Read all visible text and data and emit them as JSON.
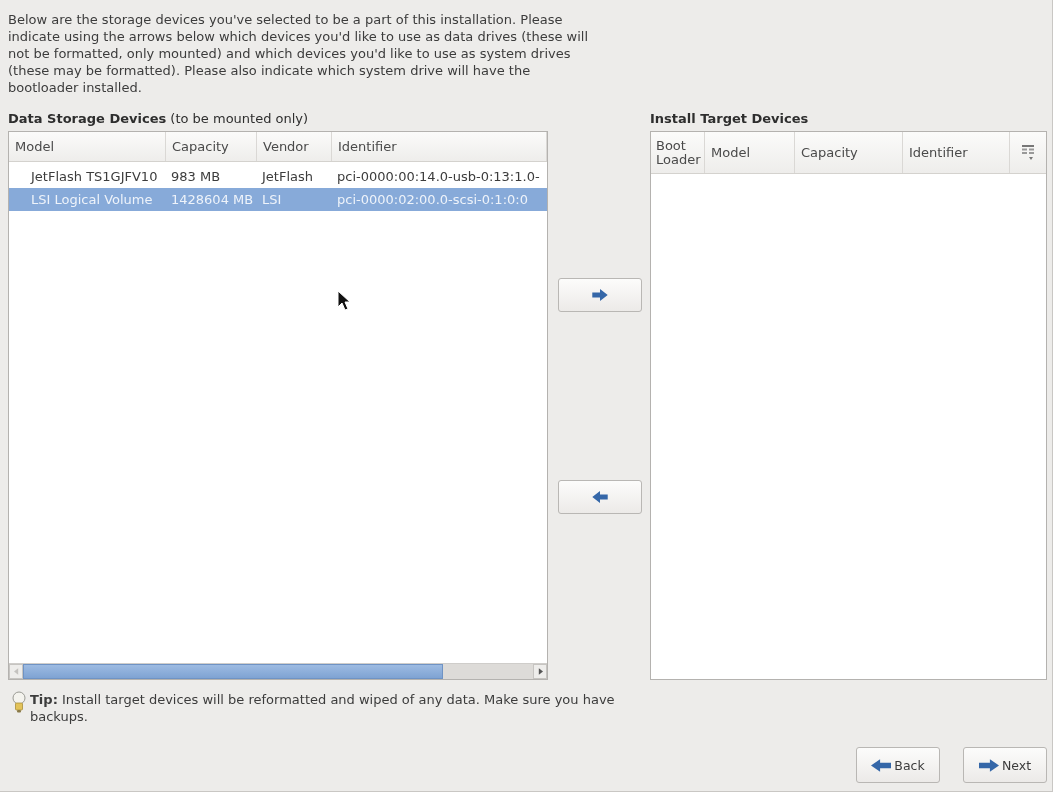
{
  "intro": {
    "text": "Below are the storage devices you've selected to be a part of this installation. Please indicate using the arrows below which devices you'd like to use as data drives (these will not be formatted, only mounted) and which devices you'd like to use as system drives (these may be formatted). Please also indicate which system drive will have the bootloader installed."
  },
  "data_storage": {
    "title": "**Data Storage Devices** (to be mounted only)",
    "columns": [
      "Model",
      "Capacity",
      "Vendor",
      "Identifier"
    ],
    "rows": [
      {
        "cells": [
          "JetFlash TS1GJFV10",
          "983 MB",
          "JetFlash",
          "pci-0000:00:14.0-usb-0:13:1.0-"
        ],
        "selected": false
      },
      {
        "cells": [
          "LSI Logical Volume",
          "1428604 MB",
          "LSI",
          "pci-0000:02:00.0-scsi-0:1:0:0"
        ],
        "selected": true
      }
    ]
  },
  "install_target": {
    "title": "Install Target Devices",
    "columns": [
      "Boot Loader",
      "Model",
      "Capacity",
      "Identifier"
    ]
  },
  "tip": {
    "text": "**Tip:** Install target devices will be reformatted and wiped of any data. Make sure you have backups."
  },
  "buttons": [
    {
      "label": "Back",
      "kind": "back"
    },
    {
      "label": "Next",
      "kind": "next"
    }
  ]
}
